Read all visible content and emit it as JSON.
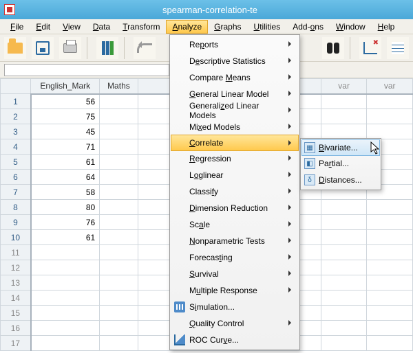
{
  "window": {
    "title": "spearman-correlation-te"
  },
  "menubar": {
    "file": "File",
    "edit": "Edit",
    "view": "View",
    "data": "Data",
    "transform": "Transform",
    "analyze": "Analyze",
    "graphs": "Graphs",
    "utilities": "Utilities",
    "addons": "Add-ons",
    "window": "Window",
    "help": "Help"
  },
  "columns": {
    "english": "English_Mark",
    "maths": "Maths",
    "var": "var"
  },
  "rows": {
    "numbers": [
      "1",
      "2",
      "3",
      "4",
      "5",
      "6",
      "7",
      "8",
      "9",
      "10",
      "11",
      "12",
      "13",
      "14",
      "15",
      "16",
      "17"
    ],
    "english_values": [
      "56",
      "75",
      "45",
      "71",
      "61",
      "64",
      "58",
      "80",
      "76",
      "61"
    ]
  },
  "analyze_menu": {
    "reports": "Reports",
    "descriptive": "Descriptive Statistics",
    "compare": "Compare Means",
    "glm": "General Linear Model",
    "genlm": "Generalized Linear Models",
    "mixed": "Mixed Models",
    "correlate": "Correlate",
    "regression": "Regression",
    "loglinear": "Loglinear",
    "classify": "Classify",
    "dimred": "Dimension Reduction",
    "scale": "Scale",
    "nonpar": "Nonparametric Tests",
    "forecast": "Forecasting",
    "survival": "Survival",
    "multiresp": "Multiple Response",
    "simulation": "Simulation...",
    "quality": "Quality Control",
    "roc": "ROC Curve..."
  },
  "correlate_submenu": {
    "bivariate": "Bivariate...",
    "partial": "Partial...",
    "distances": "Distances..."
  }
}
